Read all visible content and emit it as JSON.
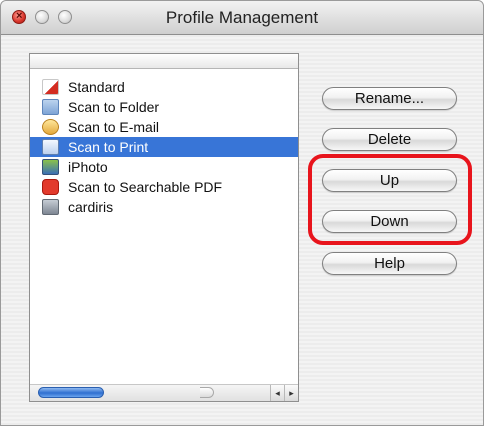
{
  "window": {
    "title": "Profile Management"
  },
  "profiles": [
    {
      "label": "Standard",
      "icon": "acrobat-icon",
      "selected": false
    },
    {
      "label": "Scan to Folder",
      "icon": "folder-icon",
      "selected": false
    },
    {
      "label": "Scan to E-mail",
      "icon": "email-icon",
      "selected": false
    },
    {
      "label": "Scan to Print",
      "icon": "printer-icon",
      "selected": true
    },
    {
      "label": "iPhoto",
      "icon": "iphoto-icon",
      "selected": false
    },
    {
      "label": "Scan to Searchable PDF",
      "icon": "searchable-pdf-icon",
      "selected": false
    },
    {
      "label": "cardiris",
      "icon": "cardiris-icon",
      "selected": false
    }
  ],
  "buttons": {
    "rename": "Rename...",
    "delete": "Delete",
    "up": "Up",
    "down": "Down",
    "help": "Help"
  },
  "colors": {
    "selection": "#3875d7",
    "highlight": "#e8141c"
  },
  "icons": {
    "scroll_left": "◂",
    "scroll_right": "▸",
    "close": "×"
  }
}
